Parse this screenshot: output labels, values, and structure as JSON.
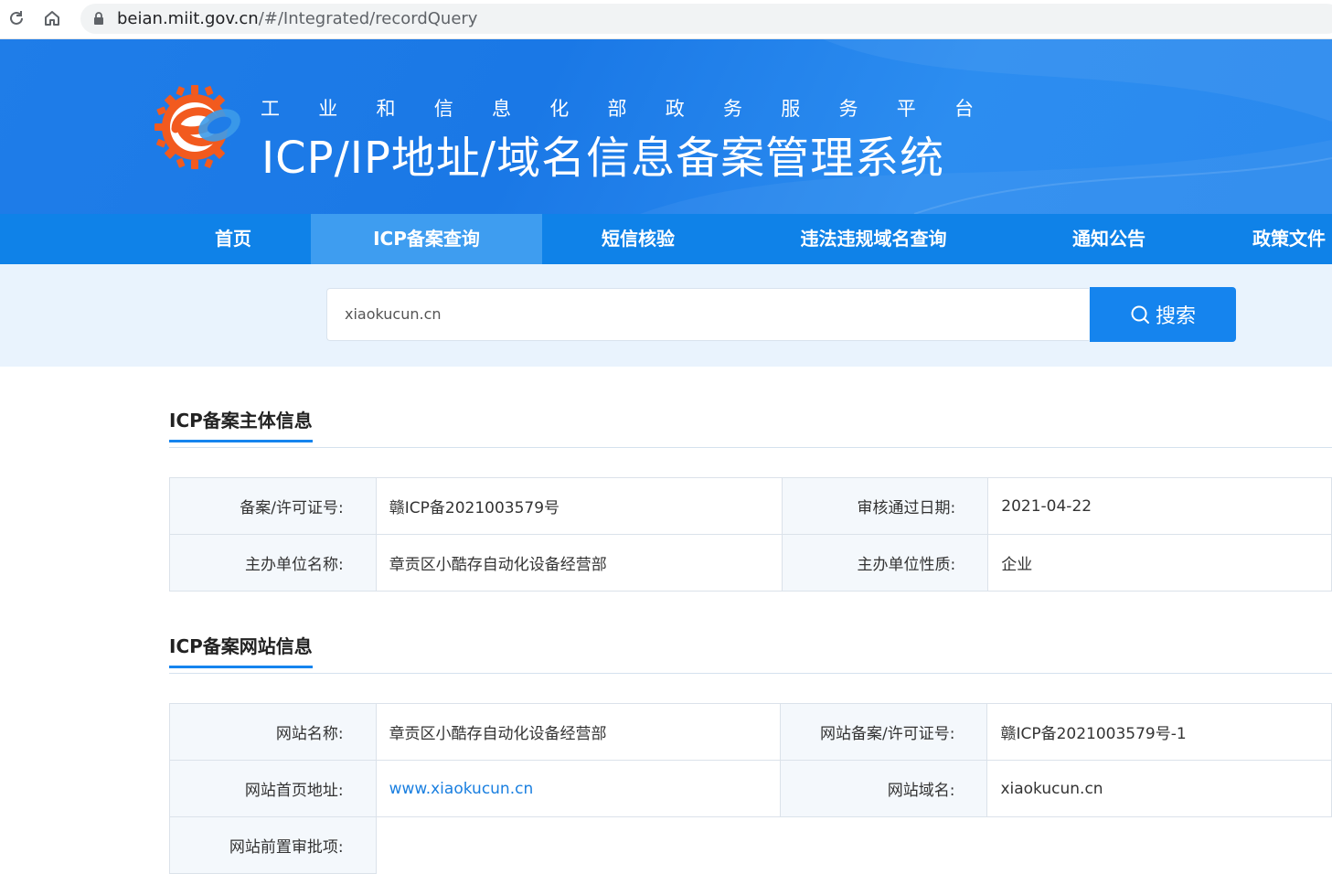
{
  "browser": {
    "url_host": "beian.miit.gov.cn",
    "url_path": "/#/Integrated/recordQuery"
  },
  "header": {
    "subtitle_chars": [
      "工",
      "业",
      "和",
      "信",
      "息",
      "化",
      "部",
      "政",
      "务",
      "服",
      "务",
      "平",
      "台"
    ],
    "title": "ICP/IP地址/域名信息备案管理系统"
  },
  "nav": {
    "items": [
      {
        "label": "首页"
      },
      {
        "label": "ICP备案查询"
      },
      {
        "label": "短信核验"
      },
      {
        "label": "违法违规域名查询"
      },
      {
        "label": "通知公告"
      },
      {
        "label": "政策文件"
      }
    ],
    "active_index": 1
  },
  "search": {
    "value": "xiaokucun.cn",
    "button_label": "搜索"
  },
  "subject_info": {
    "title": "ICP备案主体信息",
    "rows": [
      {
        "label1": "备案/许可证号:",
        "value1": "赣ICP备2021003579号",
        "label2": "审核通过日期:",
        "value2": "2021-04-22"
      },
      {
        "label1": "主办单位名称:",
        "value1": "章贡区小酷存自动化设备经营部",
        "label2": "主办单位性质:",
        "value2": "企业"
      }
    ]
  },
  "site_info": {
    "title": "ICP备案网站信息",
    "rows": [
      {
        "label1": "网站名称:",
        "value1": "章贡区小酷存自动化设备经营部",
        "label2": "网站备案/许可证号:",
        "value2": "赣ICP备2021003579号-1"
      },
      {
        "label1": "网站首页地址:",
        "value1": "www.xiaokucun.cn",
        "label2": "网站域名:",
        "value2": "xiaokucun.cn"
      },
      {
        "label1": "网站前置审批项:",
        "value1": ""
      }
    ]
  },
  "colors": {
    "primary": "#1584ee",
    "nav_bg": "#0f82e8",
    "nav_active": "#3e9df0",
    "search_band": "#e9f3fd",
    "link": "#1a7fe0"
  }
}
